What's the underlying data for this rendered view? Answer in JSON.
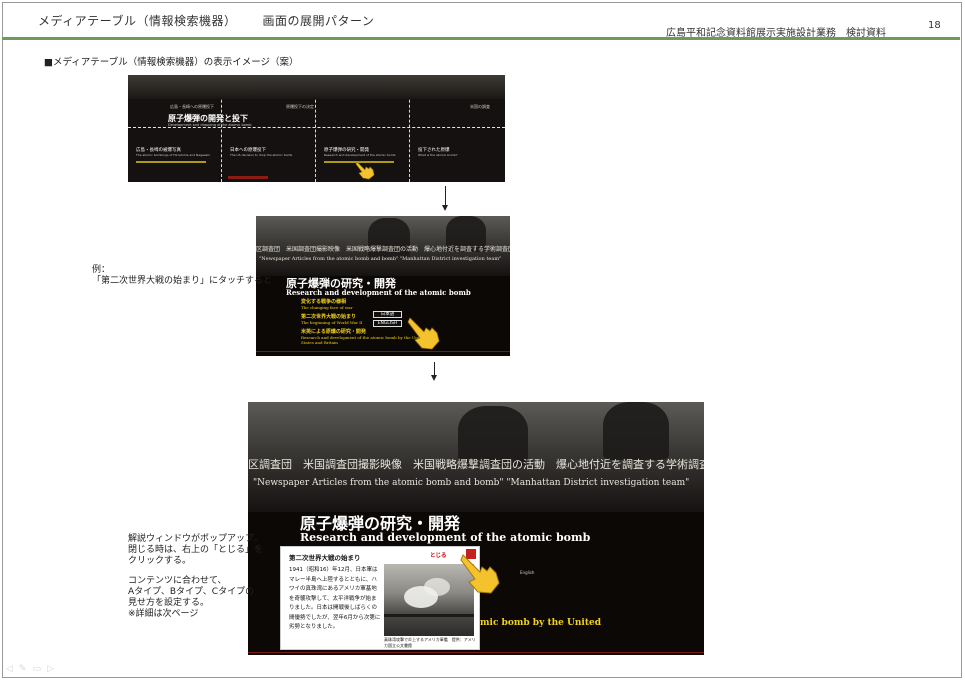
{
  "header": {
    "title": "メディアテーブル（情報検索機器）",
    "subtitle": "画面の展開パターン",
    "doc_label": "広島平和記念資料館展示実施設計業務　検討資料",
    "page_number": "18"
  },
  "section_title": "■メディアテーブル（情報検索機器）の表示イメージ（案）",
  "notes": {
    "example_line1": "例：",
    "example_line2": "「第二次世界大戦の始まり」にタッチすると",
    "popup_line1": "解説ウィンドウがポップアップ。",
    "popup_line2": "閉じる時は、右上の「とじる」を",
    "popup_line3": "クリックする。",
    "popup_line4": "コンテンツに合わせて、",
    "popup_line5": "Aタイプ、Bタイプ、Cタイプの",
    "popup_line6": "見せ方を設定する。",
    "popup_line7": "※詳細は次ページ"
  },
  "screen1": {
    "title_jp": "原子爆弾の開発と投下",
    "title_en": "Development and dropping of the atomic bomb",
    "row1": [
      "広島・長崎への原爆投下",
      "原爆投下の決定",
      "",
      "米国の調査"
    ],
    "row2": [
      "広島・長崎の被爆写真",
      "日本への原爆投下",
      "原子爆弾の研究・開発",
      "投下された原爆"
    ],
    "en_row2": [
      "The atomic bombings of Hiroshima and Nagasaki",
      "The US decision to drop the atomic bomb",
      "Research and development of the atomic bomb",
      "What is the atomic bomb?"
    ]
  },
  "screen2": {
    "strip_jp": "区調査団　米国調査団撮影映像　米国戦略爆撃調査団の活動　爆心地付近を調査する学術調査団",
    "strip_en": "\"Newspaper Articles from the atomic bomb and bomb\"  \"Manhattan District investigation team\"",
    "heading_jp": "原子爆弾の研究・開発",
    "heading_en": "Research and development of the atomic bomb",
    "items": [
      {
        "jp": "変化する戦争の様相",
        "en": "The changing face of war"
      },
      {
        "jp": "第二次世界大戦の始まり",
        "en": "The beginning of World War II"
      },
      {
        "jp": "米英による原爆の研究・開発",
        "en": "Research and development of the atomic bomb by the United"
      }
    ],
    "items_extra": "States and Britain",
    "lang_jp": "日本語",
    "lang_en": "ENGLISH"
  },
  "screen3": {
    "strip_jp": "区調査団　米国調査団撮影映像　米国戦略爆撃調査団の活動　爆心地付近を調査する学術調査団",
    "strip_en": "\"Newspaper Articles from the atomic bomb and bomb\"  \"Manhattan District investigation team\"",
    "heading_jp": "原子爆弾の研究・開発",
    "heading_en": "Research and development of the atomic bomb",
    "bg_en": "mic bomb by the United",
    "lang_small": "English"
  },
  "popup": {
    "title": "第二次世界大戦の始まり",
    "close_label": "とじる",
    "body": "1941（昭和16）年12月、日本軍はマレー半島へ上陸するとともに、ハワイの真珠湾にあるアメリカ軍基地を奇襲攻撃して、太平洋戦争が始まりました。日本は開戦後しばらくの間優勢でしたが、翌年6月から次第に劣勢となりました。",
    "caption": "真珠湾攻撃で炎上するアメリカ軍艦　提供：アメリカ国立公文書館"
  },
  "colors": {
    "accent_line": "#6f9a5f",
    "menu_yellow": "#f2d21b",
    "close_red": "#c51f1f"
  }
}
